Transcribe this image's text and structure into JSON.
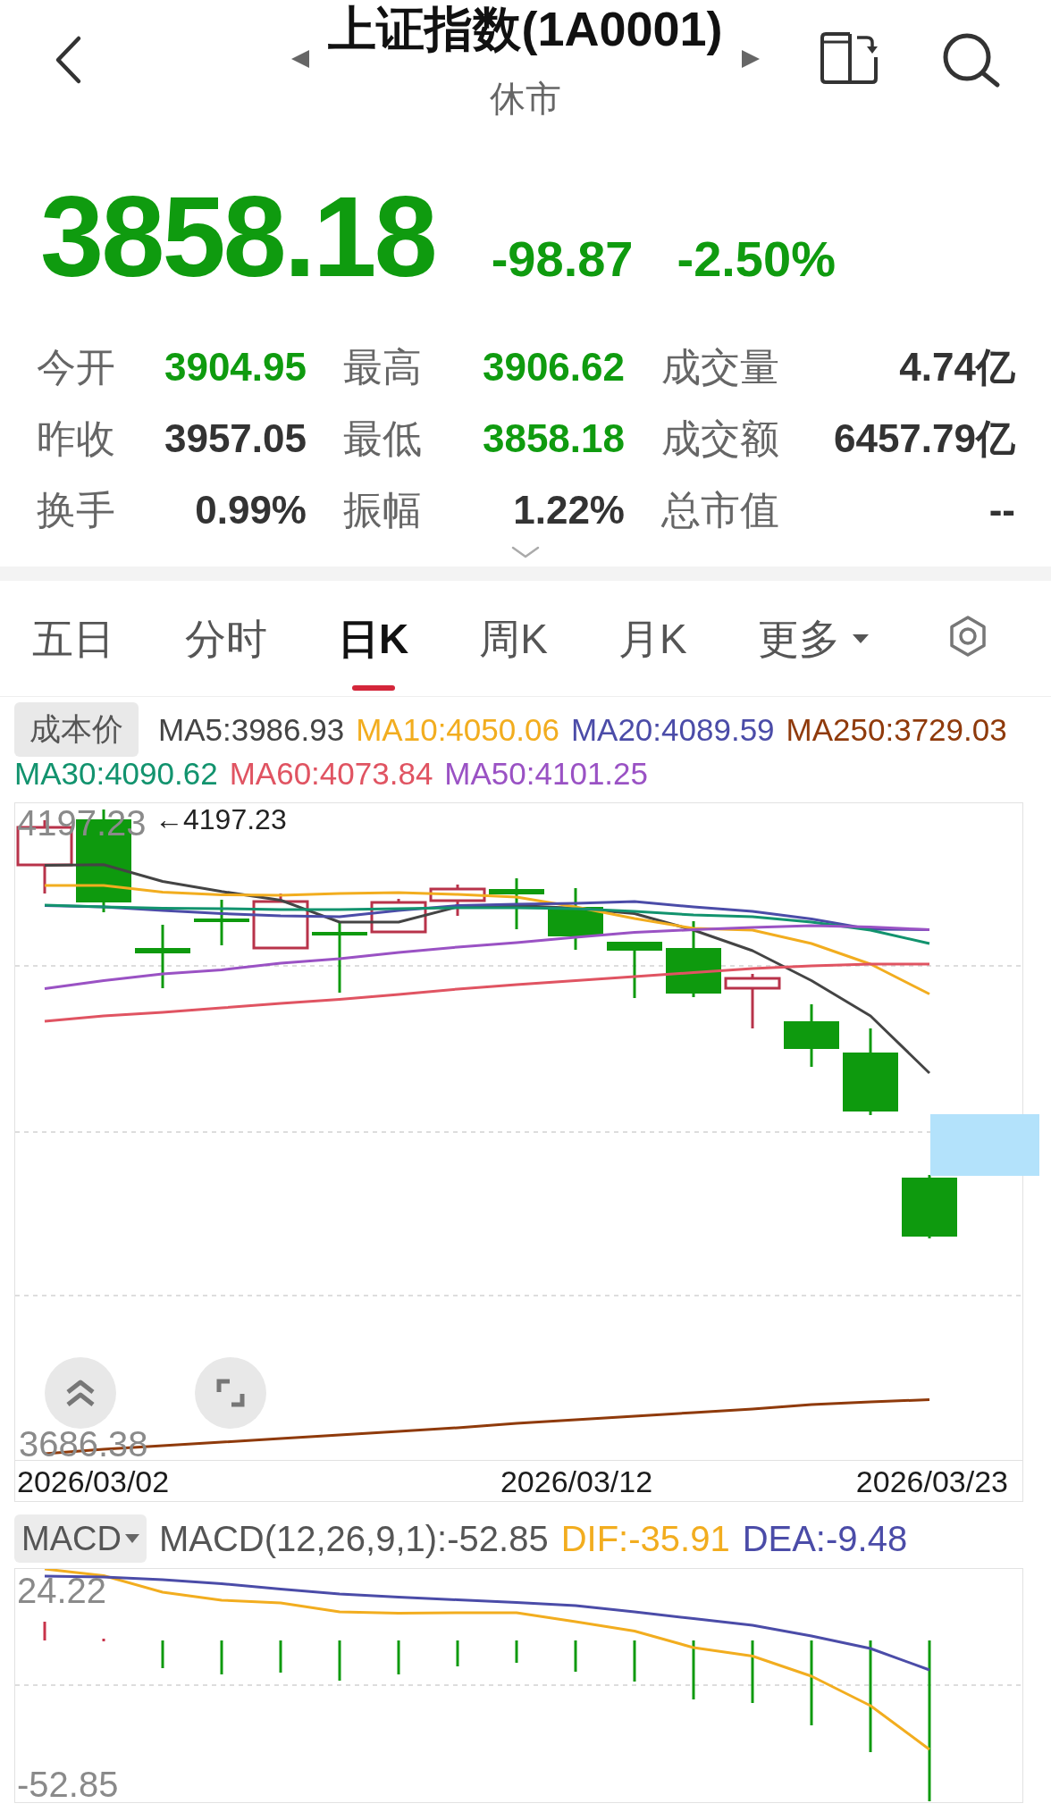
{
  "header": {
    "title": "上证指数(1A0001)",
    "status": "休市"
  },
  "quote": {
    "price": "3858.18",
    "change": "-98.87",
    "change_percent": "-2.50%",
    "falling": true
  },
  "stats": [
    {
      "label": "今开",
      "value": "3904.95",
      "falling": true
    },
    {
      "label": "最高",
      "value": "3906.62",
      "falling": true
    },
    {
      "label": "成交量",
      "value": "4.74亿",
      "falling": false
    },
    {
      "label": "昨收",
      "value": "3957.05",
      "falling": false
    },
    {
      "label": "最低",
      "value": "3858.18",
      "falling": true
    },
    {
      "label": "成交额",
      "value": "6457.79亿",
      "falling": false
    },
    {
      "label": "换手",
      "value": "0.99%",
      "falling": false
    },
    {
      "label": "振幅",
      "value": "1.22%",
      "falling": false
    },
    {
      "label": "总市值",
      "value": "--",
      "falling": false
    }
  ],
  "tabs": [
    {
      "label": "五日",
      "selected": false,
      "kind": "tab"
    },
    {
      "label": "分时",
      "selected": false,
      "kind": "tab"
    },
    {
      "label": "日K",
      "selected": true,
      "kind": "tab"
    },
    {
      "label": "周K",
      "selected": false,
      "kind": "tab"
    },
    {
      "label": "月K",
      "selected": false,
      "kind": "tab"
    },
    {
      "label": "更多",
      "selected": false,
      "kind": "menu"
    }
  ],
  "indicator_legend": {
    "cost_button": "成本价",
    "items": [
      {
        "label": "MA5:3986.93",
        "color": "#444444"
      },
      {
        "label": "MA10:4050.06",
        "color": "#f2ad1f"
      },
      {
        "label": "MA20:4089.59",
        "color": "#4b4ca8"
      },
      {
        "label": "MA250:3729.03",
        "color": "#8f3a0b"
      },
      {
        "label": "MA30:4090.62",
        "color": "#12936e"
      },
      {
        "label": "MA60:4073.84",
        "color": "#e05462"
      },
      {
        "label": "MA50:4101.25",
        "color": "#9a52c4"
      }
    ]
  },
  "kline_chart": {
    "high_label": "4197.23",
    "high_marker": "←4197.23",
    "low_label": "3686.38",
    "dates": [
      "2026/03/02",
      "2026/03/12",
      "2026/03/23"
    ]
  },
  "macd": {
    "selector": "MACD",
    "items": [
      {
        "label": "MACD(12,26,9,1):-52.85",
        "color": "#555555"
      },
      {
        "label": "DIF:-35.91",
        "color": "#f2ad1f"
      },
      {
        "label": "DEA:-9.48",
        "color": "#4b4ca8"
      }
    ],
    "top_label": "24.22",
    "bottom_label": "-52.85"
  }
}
